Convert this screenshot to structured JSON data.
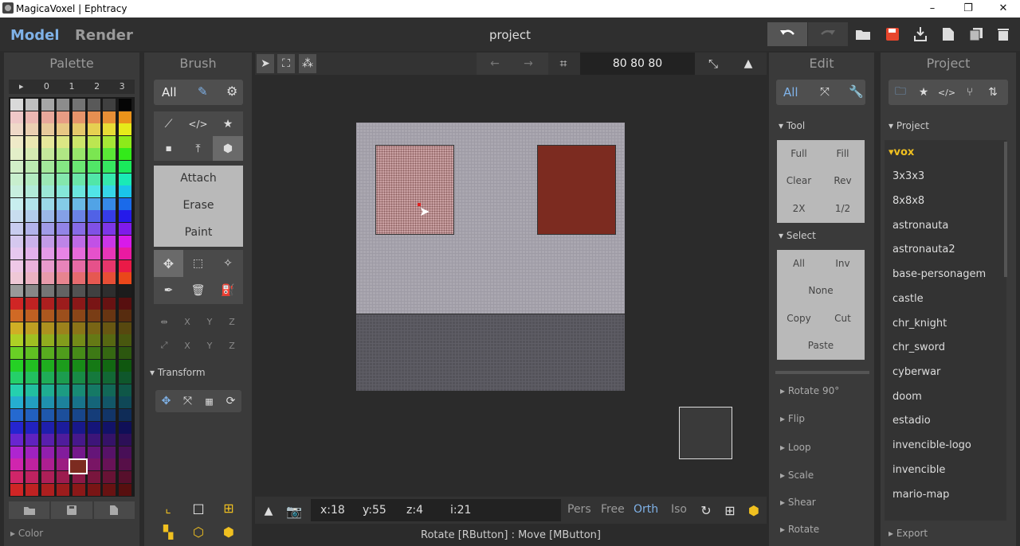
{
  "window": {
    "title": "MagicaVoxel | Ephtracy",
    "minimize": "–",
    "maximize": "❐",
    "close": "✕"
  },
  "top": {
    "model_tab": "Model",
    "render_tab": "Render",
    "project_name": "project"
  },
  "palette": {
    "header": "Palette",
    "tabs": [
      "▸",
      "0",
      "1",
      "2",
      "3"
    ],
    "footer_label": "Color"
  },
  "brush": {
    "header": "Brush",
    "all_label": "All",
    "modes": [
      "Attach",
      "Erase",
      "Paint"
    ],
    "mirror_x": "X",
    "mirror_y": "Y",
    "mirror_z": "Z",
    "transform_label": "Transform"
  },
  "viewport": {
    "dims": "80  80  80",
    "coords": {
      "x": "x:18",
      "y": "y:55",
      "z": "z:4",
      "i": "i:21"
    },
    "views": [
      "Pers",
      "Free",
      "Orth",
      "Iso"
    ],
    "active_view": "Orth",
    "status": "Rotate [RButton] : Move [MButton]"
  },
  "edit": {
    "header": "Edit",
    "all_label": "All",
    "tool_label": "Tool",
    "tool_buttons": [
      "Full",
      "Fill",
      "Clear",
      "Rev",
      "2X",
      "1/2"
    ],
    "select_label": "Select",
    "select_buttons": [
      "All",
      "Inv",
      "None",
      "Copy",
      "Cut",
      "Paste"
    ],
    "sections": [
      "Rotate 90°",
      "Flip",
      "Loop",
      "Scale",
      "Shear",
      "Rotate"
    ]
  },
  "project": {
    "header": "Project",
    "tree_label": "Project",
    "folder": "vox",
    "items": [
      "3x3x3",
      "8x8x8",
      "astronauta",
      "astronauta2",
      "base-personagem",
      "castle",
      "chr_knight",
      "chr_sword",
      "cyberwar",
      "doom",
      "estadio",
      "invencible-logo",
      "invencible",
      "mario-map"
    ],
    "export_label": "Export"
  },
  "colors": {
    "accent": "#7fb2e8",
    "selected_color": "#7c2b20",
    "folder_yellow": "#f0c020"
  }
}
